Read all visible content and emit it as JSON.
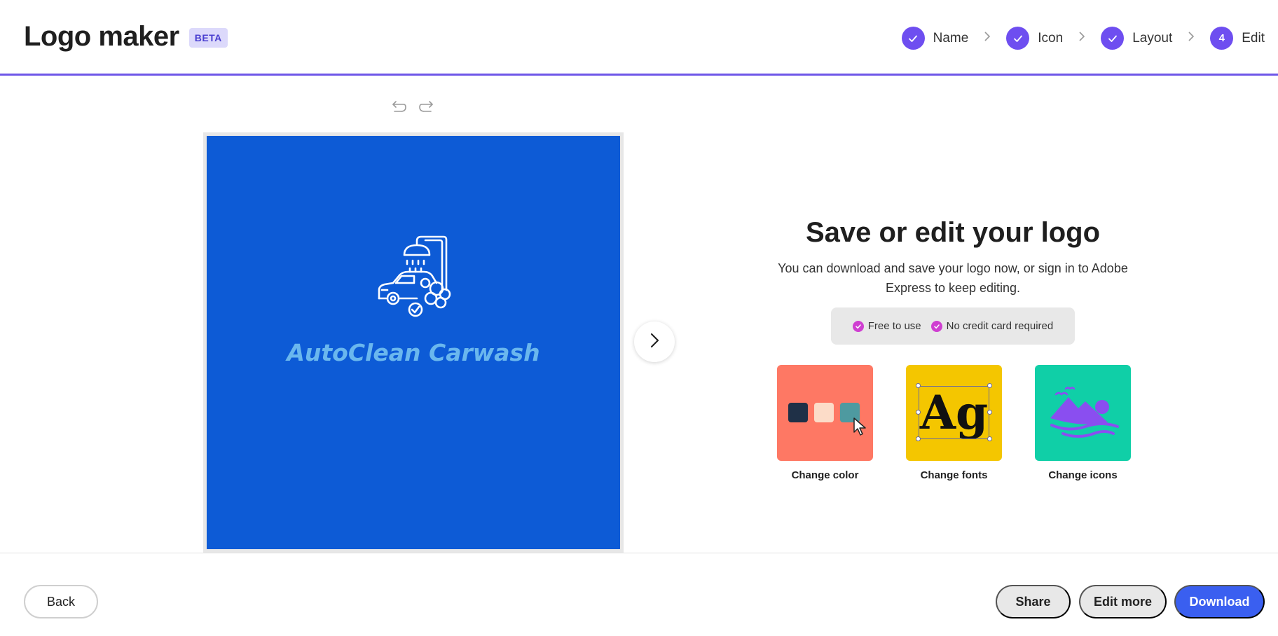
{
  "app": {
    "title": "Logo maker",
    "badge": "BETA"
  },
  "steps": [
    {
      "label": "Name",
      "status": "complete",
      "marker": "check-icon"
    },
    {
      "label": "Icon",
      "status": "complete",
      "marker": "check-icon"
    },
    {
      "label": "Layout",
      "status": "complete",
      "marker": "check-icon"
    },
    {
      "label": "Edit",
      "status": "current",
      "marker": "4"
    }
  ],
  "toolbar": {
    "undo_icon": "undo-icon",
    "redo_icon": "redo-icon"
  },
  "canvas": {
    "background_color": "#0d5bd6",
    "logo_icon": "car-wash-icon",
    "logo_text": "AutoClean Carwash",
    "logo_text_color": "#6ab7ee",
    "next_icon": "chevron-right-icon"
  },
  "panel": {
    "title": "Save or edit your logo",
    "description": "You can download and save your logo now, or sign in to Adobe Express to keep editing.",
    "badges": [
      {
        "label": "Free to use",
        "icon": "check-circle-icon"
      },
      {
        "label": "No credit card required",
        "icon": "check-circle-icon"
      }
    ],
    "options": [
      {
        "label": "Change color",
        "tile_color": "#fe7864",
        "swatch_colors": [
          "#1f3047",
          "#fcdcc8",
          "#4e9aa0"
        ]
      },
      {
        "label": "Change fonts",
        "tile_color": "#f4c600",
        "sample_text": "Ag"
      },
      {
        "label": "Change icons",
        "tile_color": "#10cfa7",
        "icon": "landscape-icon",
        "icon_color": "#8a4ef0"
      }
    ]
  },
  "footer": {
    "back_label": "Back",
    "share_label": "Share",
    "edit_more_label": "Edit more",
    "download_label": "Download"
  },
  "colors": {
    "accent": "#6e4ef0",
    "primary_button": "#3a5ff0",
    "badge_check": "#cf3fd1"
  }
}
